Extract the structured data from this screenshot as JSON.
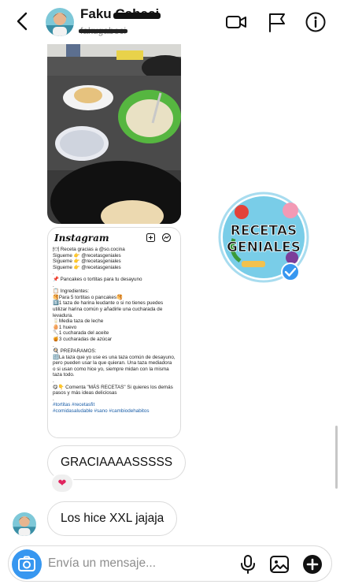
{
  "header": {
    "name_first": "Faku",
    "name_redacted": "Cabeci",
    "username": "fakugabeci"
  },
  "post": {
    "logo": "Instagram",
    "lines": [
      "🍽 Receta gracias a @so.cocina\nSigueme 👉 @recetasgeniales\nSigueme 👉 @recetasgeniales\nSigueme 👉 @recetasgeniales\n.",
      "📌 Pancakes o tortitas para tu desayuno\n.",
      "📋 Ingredientes:\n🥞Para 5 tortitas o pancakes🥞\n1️⃣1 taza de harina leudante o si no tienes puedes utilizar harina común y añadirle una cucharada de levadura.\n🥛Media taza de leche\n🥚1 huevo\n🥄1 cucharada del aceite\n🍯3 cucharadas de azúcar\n.",
      "🍳 PREPARAMOS:\n🔢La taza que yo use es una taza común de desayuno, pero pueden usar la que quieran. Una taza mediadora o si usan como hice yo, siempre midan con la misma taza todo.\n.",
      "😋👇 Comenta \"MÁS RECETAS\" Si quieres los demás pasos y más ideas deliciosas\n."
    ],
    "tags": "#tortitas #recetasfit\n#comidasaludable #sano #cambiodehabitos"
  },
  "sticker": {
    "line1": "RECETAS",
    "line2": "GENIALES"
  },
  "messages": {
    "sent": "GRACIAAAASSSSS",
    "reaction": "❤",
    "received": "Los hice XXL jajaja"
  },
  "composer": {
    "placeholder": "Envía un mensaje..."
  },
  "colors": {
    "accent": "#3797f0",
    "heart": "#e0245e",
    "post_tag": "#1a5ea8"
  }
}
